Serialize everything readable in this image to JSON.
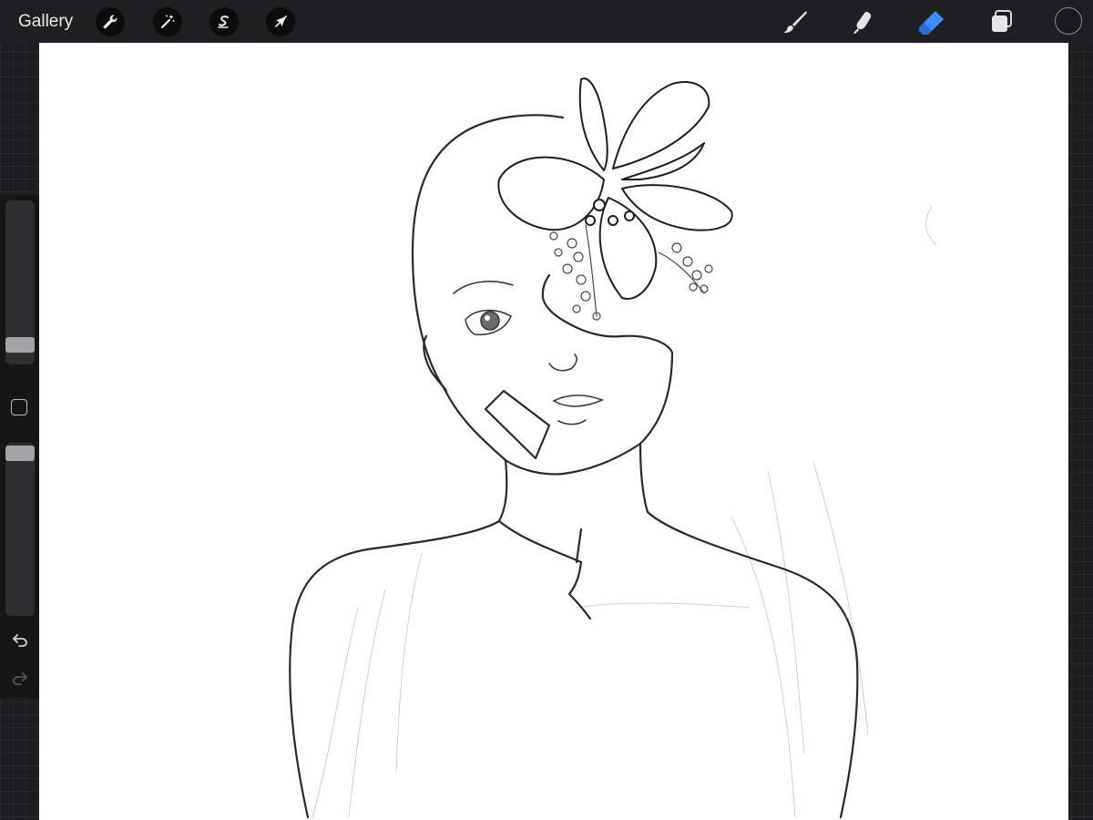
{
  "toolbar": {
    "gallery_label": "Gallery",
    "left_tools": [
      {
        "icon": "wrench-icon",
        "name": "actions"
      },
      {
        "icon": "magic-wand-icon",
        "name": "adjustments"
      },
      {
        "icon": "selection-s-icon",
        "name": "selection"
      },
      {
        "icon": "arrow-cursor-icon",
        "name": "transform"
      }
    ],
    "right_tools": [
      {
        "icon": "brush-icon",
        "name": "paint"
      },
      {
        "icon": "smudge-icon",
        "name": "smudge"
      },
      {
        "icon": "eraser-icon",
        "name": "erase",
        "active": true
      },
      {
        "icon": "layers-icon",
        "name": "layers"
      }
    ],
    "current_color": "#1a1a1c"
  },
  "sidebar": {
    "brush_size_level": 0.08,
    "brush_opacity_level": 0.98,
    "undo_icon": "undo-icon",
    "redo_icon": "redo-icon"
  },
  "colors": {
    "accent": "#3a8dff",
    "chrome": "#1f1f21",
    "canvas": "#ffffff"
  }
}
